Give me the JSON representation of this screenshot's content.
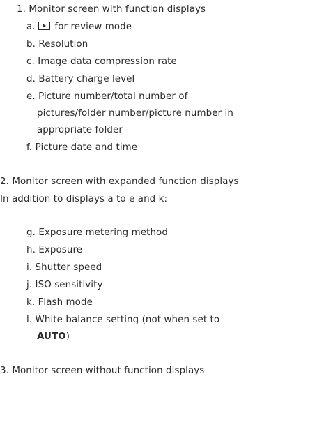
{
  "items": {
    "i1": {
      "number": "1.",
      "text": "Monitor screen with function displays"
    },
    "a": {
      "letter": "a.",
      "text": "for review mode",
      "icon": "play-review-icon"
    },
    "b": {
      "letter": "b.",
      "text": "Resolution"
    },
    "c": {
      "letter": "c.",
      "text": "Image data compression rate"
    },
    "d": {
      "letter": "d.",
      "text": "Battery charge level"
    },
    "e": {
      "letter": "e.",
      "text": "Picture number/total number of",
      "cont1": "pictures/folder number/picture number in",
      "cont2": "appropriate folder"
    },
    "f": {
      "letter": "f.",
      "text": "Picture date and time"
    },
    "i2": {
      "number": "2.",
      "text": "Monitor screen with expanded function displays"
    },
    "i2_note": "In addition to displays a to e and k:",
    "g": {
      "letter": "g.",
      "text": "Exposure metering method"
    },
    "h": {
      "letter": "h.",
      "text": "Exposure"
    },
    "i": {
      "letter": "i.",
      "text": "Shutter speed"
    },
    "j": {
      "letter": "j.",
      "text": "ISO sensitivity"
    },
    "k": {
      "letter": "k.",
      "text": "Flash mode"
    },
    "l": {
      "letter": "l.",
      "text": "White balance setting (not when set to",
      "cont_bold": "AUTO",
      "cont_end": ")"
    },
    "i3": {
      "number": "3.",
      "text": "Monitor screen without function displays"
    }
  }
}
